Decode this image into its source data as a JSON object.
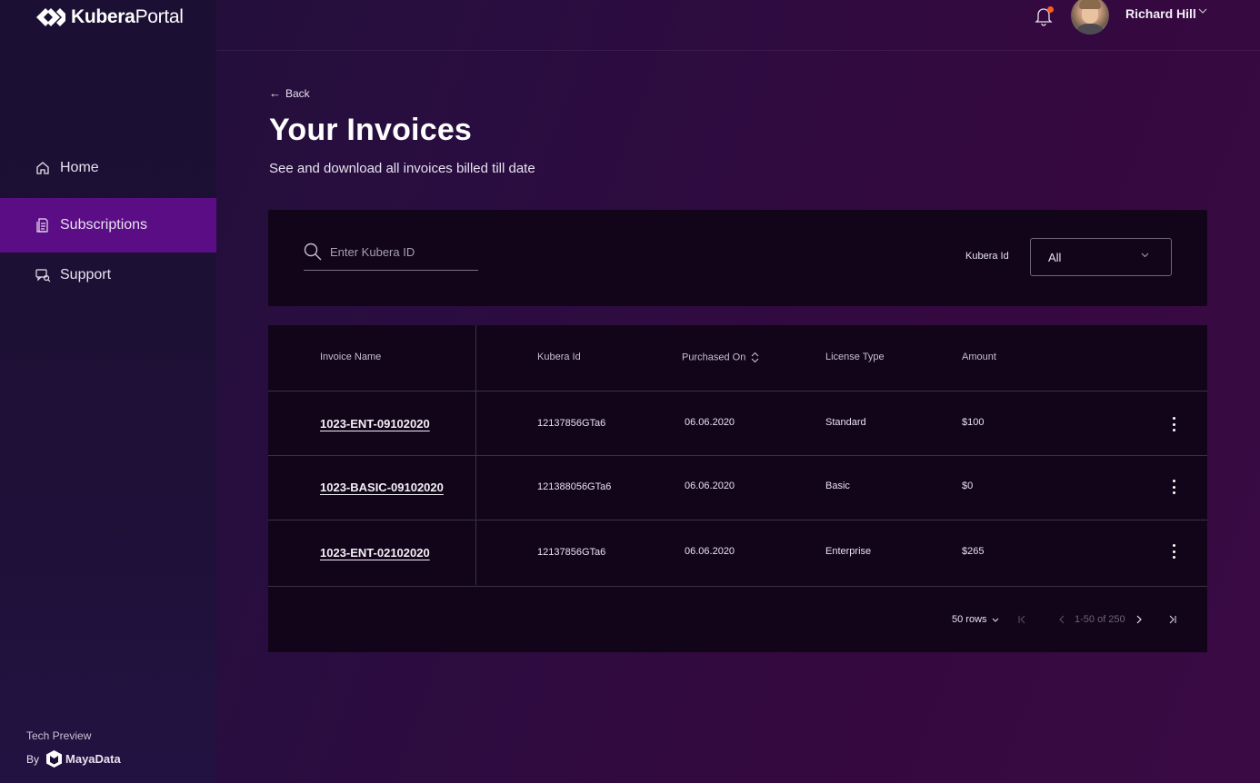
{
  "app": {
    "logo_bold": "Kubera",
    "logo_light": "Portal"
  },
  "sidebar": {
    "items": [
      {
        "label": "Home",
        "icon": "home-icon",
        "active": false
      },
      {
        "label": "Subscriptions",
        "icon": "document-icon",
        "active": true
      },
      {
        "label": "Support",
        "icon": "support-icon",
        "active": false
      }
    ],
    "footer": {
      "tech_preview": "Tech Preview",
      "by": "By",
      "brand": "MayaData"
    }
  },
  "header": {
    "user_name": "Richard Hill",
    "notification_dot_color": "#ff5c1b"
  },
  "main": {
    "back_label": "Back",
    "title": "Your Invoices",
    "subtitle": "See and download all invoices billed till date"
  },
  "filters": {
    "search_placeholder": "Enter Kubera ID",
    "search_value": "",
    "kubera_id_label": "Kubera Id",
    "kubera_id_selected": "All"
  },
  "table": {
    "columns": [
      "Invoice Name",
      "Kubera Id",
      "Purchased On",
      "License Type",
      "Amount"
    ],
    "rows": [
      {
        "invoice": "1023-ENT-09102020",
        "kubera_id": "12137856GTa6",
        "purchased_on": "06.06.2020",
        "license": "Standard",
        "amount": "$100"
      },
      {
        "invoice": "1023-BASIC-09102020",
        "kubera_id": "121388056GTa6",
        "purchased_on": "06.06.2020",
        "license": "Basic",
        "amount": "$0"
      },
      {
        "invoice": "1023-ENT-02102020",
        "kubera_id": "12137856GTa6",
        "purchased_on": "06.06.2020",
        "license": "Enterprise",
        "amount": "$265"
      }
    ]
  },
  "pagination": {
    "rows_per_page": "50 rows",
    "range": "1-50 of 250"
  },
  "colors": {
    "active_nav": "#5b0d85",
    "card_bg": "#12051a"
  }
}
